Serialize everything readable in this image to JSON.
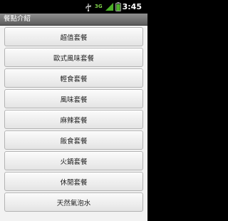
{
  "status_bar": {
    "network_label": "3G",
    "time": "3:45",
    "icons": [
      "usb-icon",
      "network-3g-icon",
      "signal-icon",
      "battery-icon"
    ]
  },
  "title_bar": {
    "title": "餐點介紹"
  },
  "menu": {
    "items": [
      {
        "label": "超值套餐"
      },
      {
        "label": "歐式風味套餐"
      },
      {
        "label": "輕食套餐"
      },
      {
        "label": "風味套餐"
      },
      {
        "label": "麻辣套餐"
      },
      {
        "label": "飯食套餐"
      },
      {
        "label": "火鍋套餐"
      },
      {
        "label": "休閒套餐"
      },
      {
        "label": "天然氣泡水"
      }
    ]
  },
  "colors": {
    "status_bar_bg": "#000000",
    "title_bar_bg": "#7a7a7a",
    "content_bg": "#f2f2f2",
    "button_bg": "#efefef",
    "signal_green": "#4caf28"
  }
}
